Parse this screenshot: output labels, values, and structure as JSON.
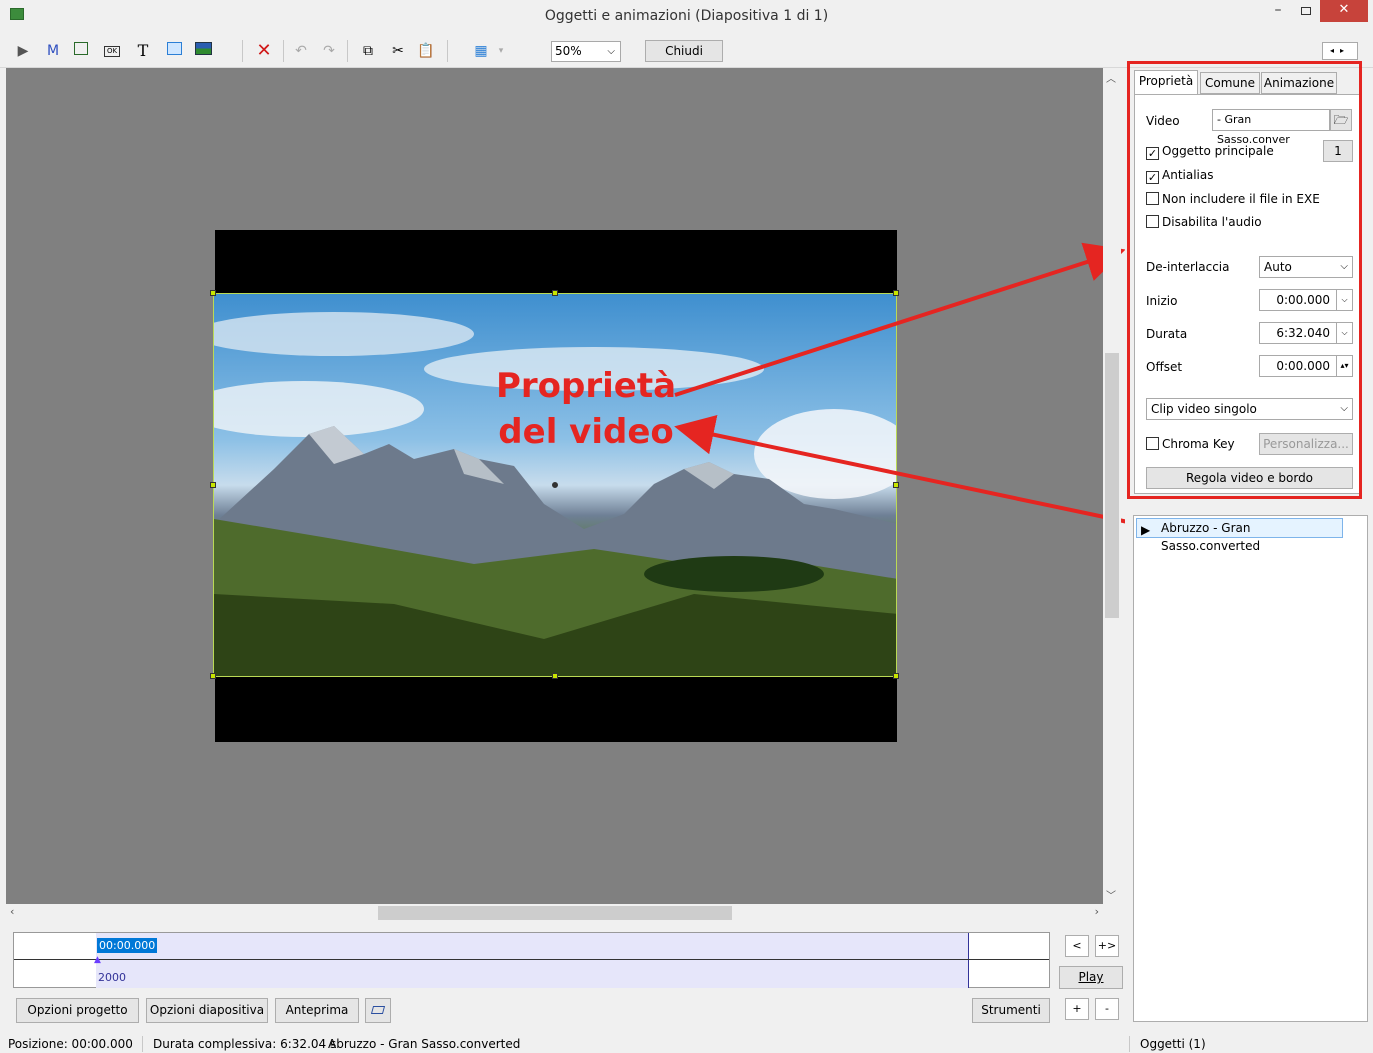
{
  "window": {
    "title": "Oggetti e animazioni  (Diapositiva 1 di 1)",
    "min": "–",
    "close": "✕"
  },
  "toolbar": {
    "zoom": "50%",
    "close_label": "Chiudi",
    "icons": [
      "video-icon",
      "mask-icon",
      "frame-icon",
      "button-icon",
      "text-icon",
      "rectangle-icon",
      "image-icon",
      "delete-icon",
      "undo-icon",
      "redo-icon",
      "copy-icon",
      "cut-icon",
      "paste-icon",
      "grid-icon"
    ]
  },
  "canvas": {
    "overlay_line1": "Proprietà",
    "overlay_line2": "del video"
  },
  "timeline": {
    "time": "00:00.000",
    "value": "2000",
    "play": "Play",
    "prev": "<",
    "expand": "+>",
    "plus": "+",
    "minus": "-"
  },
  "buttons": {
    "project_options": "Opzioni progetto",
    "slide_options": "Opzioni diapositiva",
    "preview": "Anteprima",
    "tools": "Strumenti"
  },
  "status": {
    "position": "Posizione:  00:00.000",
    "duration": "Durata complessiva:  6:32.04 s",
    "file": "Abruzzo - Gran Sasso.converted",
    "objects": "Oggetti (1)"
  },
  "tabs": [
    "Proprietà",
    "Comune",
    "Animazione"
  ],
  "props": {
    "video_label": "Video",
    "video_value": "- Gran Sasso.conver",
    "main_object": "Oggetto principale",
    "main_object_checked": true,
    "main_object_num": "1",
    "antialias": "Antialias",
    "antialias_checked": true,
    "no_exe": "Non includere il file in EXE",
    "disable_audio": "Disabilita l'audio",
    "deinterlace_label": "De-interlaccia",
    "deinterlace_value": "Auto",
    "start_label": "Inizio",
    "start_value": "0:00.000",
    "duration_label": "Durata",
    "duration_value": "6:32.040",
    "offset_label": "Offset",
    "offset_value": "0:00.000",
    "clip_mode": "Clip video singolo",
    "chroma_key": "Chroma Key",
    "customize": "Personalizza...",
    "adjust": "Regola video e bordo"
  },
  "object_list": [
    {
      "label": "Abruzzo - Gran Sasso.converted"
    }
  ],
  "colors": {
    "annotation": "#e52521",
    "selection": "#0078d7",
    "timeline": "#e6e6fa"
  }
}
